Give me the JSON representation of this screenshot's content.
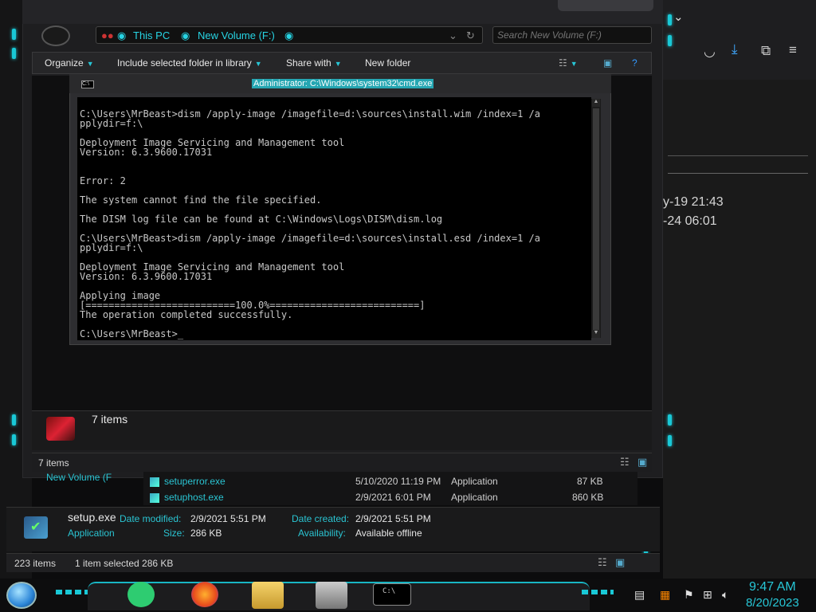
{
  "explorer": {
    "breadcrumb": [
      "This PC",
      "New Volume (F:)"
    ],
    "search_placeholder": "Search New Volume (F:)",
    "toolbar": {
      "organize": "Organize",
      "include_library": "Include selected folder in library",
      "share_with": "Share with",
      "new_folder": "New folder"
    },
    "details_count": "7 items",
    "status_count": "7 items"
  },
  "cmd": {
    "title": "Administrator: C:\\Windows\\system32\\cmd.exe",
    "icon_label": "C:\\",
    "lines": [
      "",
      "C:\\Users\\MrBeast>dism /apply-image /imagefile=d:\\sources\\install.wim /index=1 /a",
      "pplydir=f:\\",
      "",
      "Deployment Image Servicing and Management tool",
      "Version: 6.3.9600.17031",
      "",
      "",
      "Error: 2",
      "",
      "The system cannot find the file specified.",
      "",
      "The DISM log file can be found at C:\\Windows\\Logs\\DISM\\dism.log",
      "",
      "C:\\Users\\MrBeast>dism /apply-image /imagefile=d:\\sources\\install.esd /index=1 /a",
      "pplydir=f:\\",
      "",
      "Deployment Image Servicing and Management tool",
      "Version: 6.3.9600.17031",
      "",
      "Applying image",
      "[==========================100.0%==========================]",
      "The operation completed successfully.",
      "",
      "C:\\Users\\MrBeast>_"
    ]
  },
  "background_files": [
    {
      "name": "setuperror.exe",
      "date": "5/10/2020 11:19 PM",
      "type": "Application",
      "size": "87 KB"
    },
    {
      "name": "setuphost.exe",
      "date": "2/9/2021 6:01 PM",
      "type": "Application",
      "size": "860 KB"
    }
  ],
  "bg_nav_fragment": "New Volume (F",
  "right_window": {
    "date1": "y-19 21:43",
    "date2": "-24 06:01"
  },
  "selected_file": {
    "name": "setup.exe",
    "type": "Application",
    "date_modified_label": "Date modified:",
    "date_modified": "2/9/2021 5:51 PM",
    "size_label": "Size:",
    "size": "286 KB",
    "date_created_label": "Date created:",
    "date_created": "2/9/2021 5:51 PM",
    "availability_label": "Availability:",
    "availability": "Available offline"
  },
  "bottom_status": {
    "items": "223 items",
    "selected": "1 item selected  286 KB"
  },
  "taskbar": {
    "time": "9:47 AM",
    "date": "8/20/2023"
  },
  "colors": {
    "accent": "#27c6d6",
    "cmd_title_bg": "#25a6b2"
  }
}
